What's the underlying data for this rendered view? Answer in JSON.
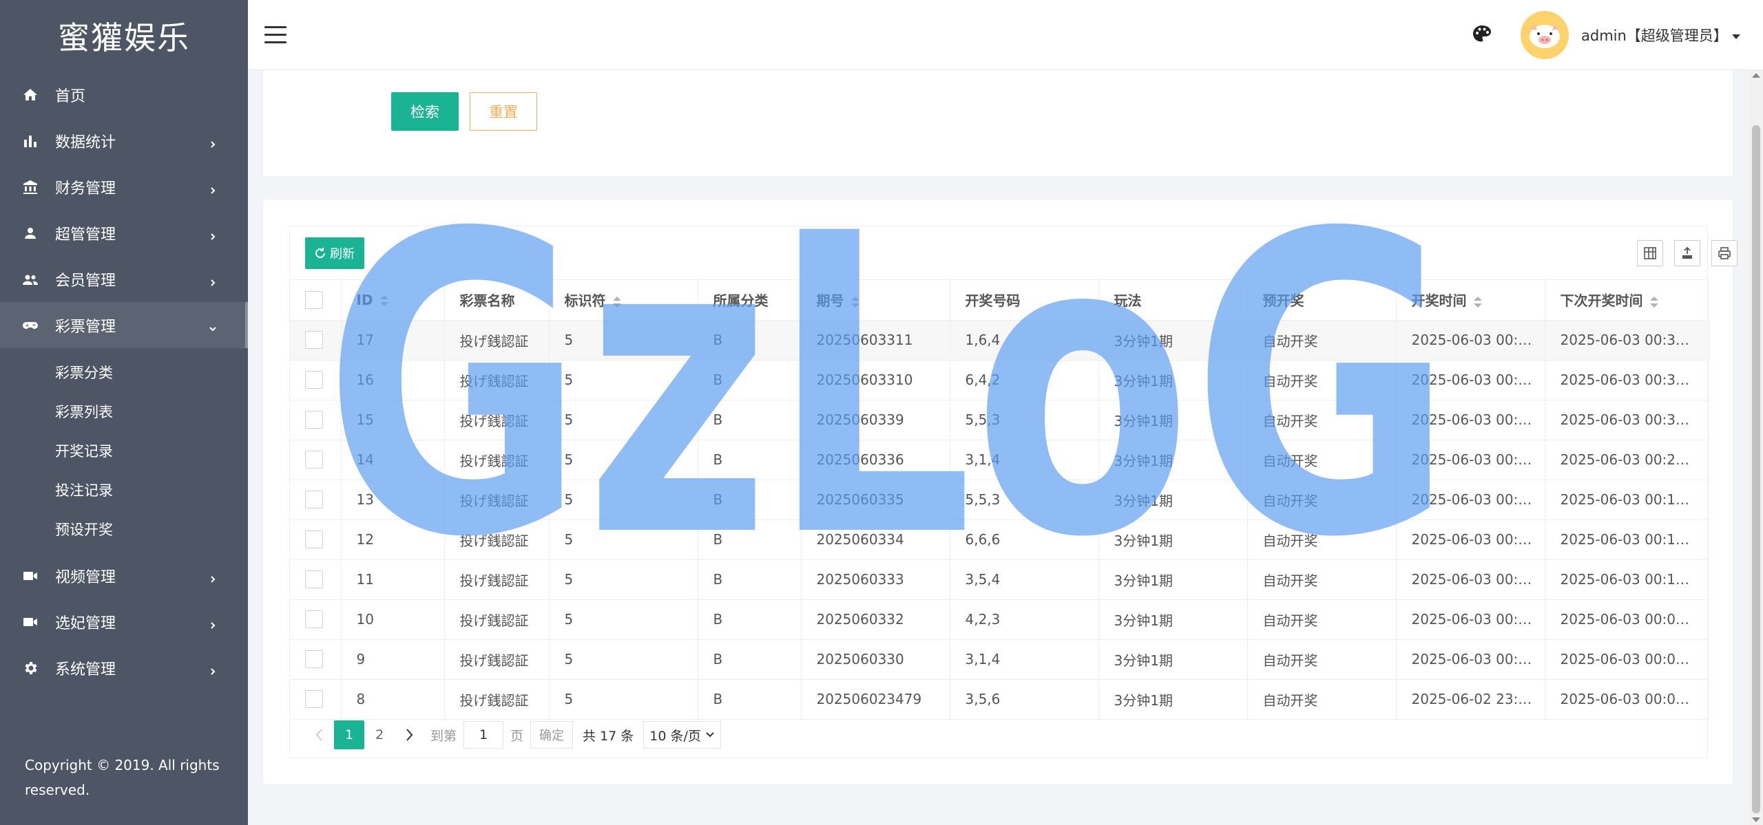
{
  "brand": "蜜獾娱乐",
  "sidebar": {
    "menu": [
      {
        "label": "首页",
        "icon": "home-icon",
        "has_arrow": false
      },
      {
        "label": "数据统计",
        "icon": "bar-chart-icon",
        "has_arrow": true
      },
      {
        "label": "财务管理",
        "icon": "bank-icon",
        "has_arrow": true
      },
      {
        "label": "超管管理",
        "icon": "user-icon",
        "has_arrow": true
      },
      {
        "label": "会员管理",
        "icon": "users-icon",
        "has_arrow": true
      },
      {
        "label": "彩票管理",
        "icon": "gamepad-icon",
        "has_arrow": true,
        "expanded": true
      },
      {
        "label": "视频管理",
        "icon": "video-icon",
        "has_arrow": true
      },
      {
        "label": "选妃管理",
        "icon": "video-icon",
        "has_arrow": true
      },
      {
        "label": "系统管理",
        "icon": "gear-icon",
        "has_arrow": true
      }
    ],
    "submenu": [
      "彩票分类",
      "彩票列表",
      "开奖记录",
      "投注记录",
      "预设开奖"
    ],
    "copyright": "Copyright © 2019. All rights reserved."
  },
  "header": {
    "user": "admin【超级管理员】"
  },
  "search": {
    "search_label": "检索",
    "reset_label": "重置"
  },
  "toolbar": {
    "refresh_label": "刷新"
  },
  "table": {
    "columns": [
      "ID",
      "彩票名称",
      "标识符",
      "所属分类",
      "期号",
      "开奖号码",
      "玩法",
      "预开奖",
      "开奖时间",
      "下次开奖时间"
    ],
    "rows": [
      [
        "17",
        "投げ銭認証",
        "5",
        "B",
        "20250603311",
        "1,6,4",
        "3分钟1期",
        "自动开奖",
        "2025-06-03 00:…",
        "2025-06-03 00:3…"
      ],
      [
        "16",
        "投げ銭認証",
        "5",
        "B",
        "20250603310",
        "6,4,2",
        "3分钟1期",
        "自动开奖",
        "2025-06-03 00:…",
        "2025-06-03 00:3…"
      ],
      [
        "15",
        "投げ銭認証",
        "5",
        "B",
        "2025060339",
        "5,5,3",
        "3分钟1期",
        "自动开奖",
        "2025-06-03 00:…",
        "2025-06-03 00:3…"
      ],
      [
        "14",
        "投げ銭認証",
        "5",
        "B",
        "2025060336",
        "3,1,4",
        "3分钟1期",
        "自动开奖",
        "2025-06-03 00:…",
        "2025-06-03 00:2…"
      ],
      [
        "13",
        "投げ銭認証",
        "5",
        "B",
        "2025060335",
        "5,5,3",
        "3分钟1期",
        "自动开奖",
        "2025-06-03 00:…",
        "2025-06-03 00:1…"
      ],
      [
        "12",
        "投げ銭認証",
        "5",
        "B",
        "2025060334",
        "6,6,6",
        "3分钟1期",
        "自动开奖",
        "2025-06-03 00:…",
        "2025-06-03 00:1…"
      ],
      [
        "11",
        "投げ銭認証",
        "5",
        "B",
        "2025060333",
        "3,5,4",
        "3分钟1期",
        "自动开奖",
        "2025-06-03 00:…",
        "2025-06-03 00:1…"
      ],
      [
        "10",
        "投げ銭認証",
        "5",
        "B",
        "2025060332",
        "4,2,3",
        "3分钟1期",
        "自动开奖",
        "2025-06-03 00:…",
        "2025-06-03 00:0…"
      ],
      [
        "9",
        "投げ銭認証",
        "5",
        "B",
        "2025060330",
        "3,1,4",
        "3分钟1期",
        "自动开奖",
        "2025-06-03 00:…",
        "2025-06-03 00:0…"
      ],
      [
        "8",
        "投げ銭認証",
        "5",
        "B",
        "202506023479",
        "3,5,6",
        "3分钟1期",
        "自动开奖",
        "2025-06-02 23:…",
        "2025-06-03 00:0…"
      ]
    ]
  },
  "pager": {
    "pages": [
      "1",
      "2"
    ],
    "goto_label": "到第",
    "page_input": "1",
    "page_unit": "页",
    "confirm_label": "确定",
    "total": "共 17 条",
    "per_page": "10 条/页"
  },
  "watermark": "GzLoG",
  "colors": {
    "accent": "#1ab394",
    "warning": "#f8ac59",
    "sidebar": "#4e5565",
    "watermark": "#5b9cf0"
  }
}
